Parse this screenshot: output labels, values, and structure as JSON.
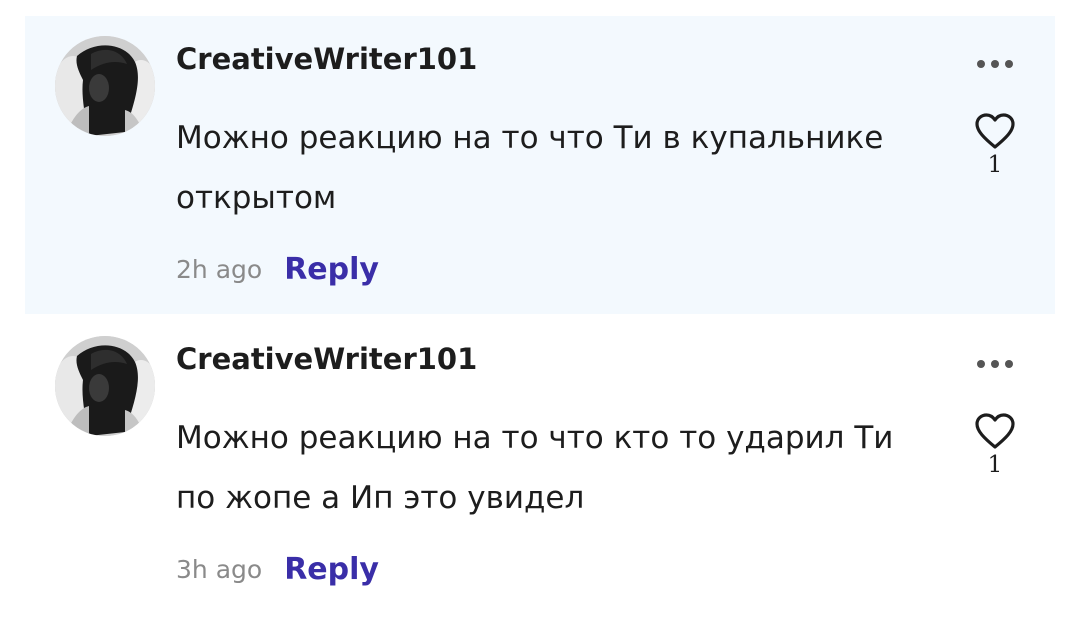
{
  "comments": [
    {
      "username": "CreativeWriter101",
      "text": "Можно реакцию на то что Ти в купальнике открытом",
      "time": "2h ago",
      "reply_label": "Reply",
      "like_count": "1",
      "highlighted": true
    },
    {
      "username": "CreativeWriter101",
      "text": "Можно реакцию на то что кто то ударил Ти по жопе а Ип это увидел",
      "time": "3h ago",
      "reply_label": "Reply",
      "like_count": "1",
      "highlighted": false
    }
  ],
  "icons": {
    "more": "more-horizontal-icon",
    "like": "heart-outline-icon"
  },
  "colors": {
    "highlight_background": "#f3f9fe",
    "reply_link": "#3a2ea8",
    "timestamp": "#8a8a8a",
    "text": "#1d1d1d"
  }
}
